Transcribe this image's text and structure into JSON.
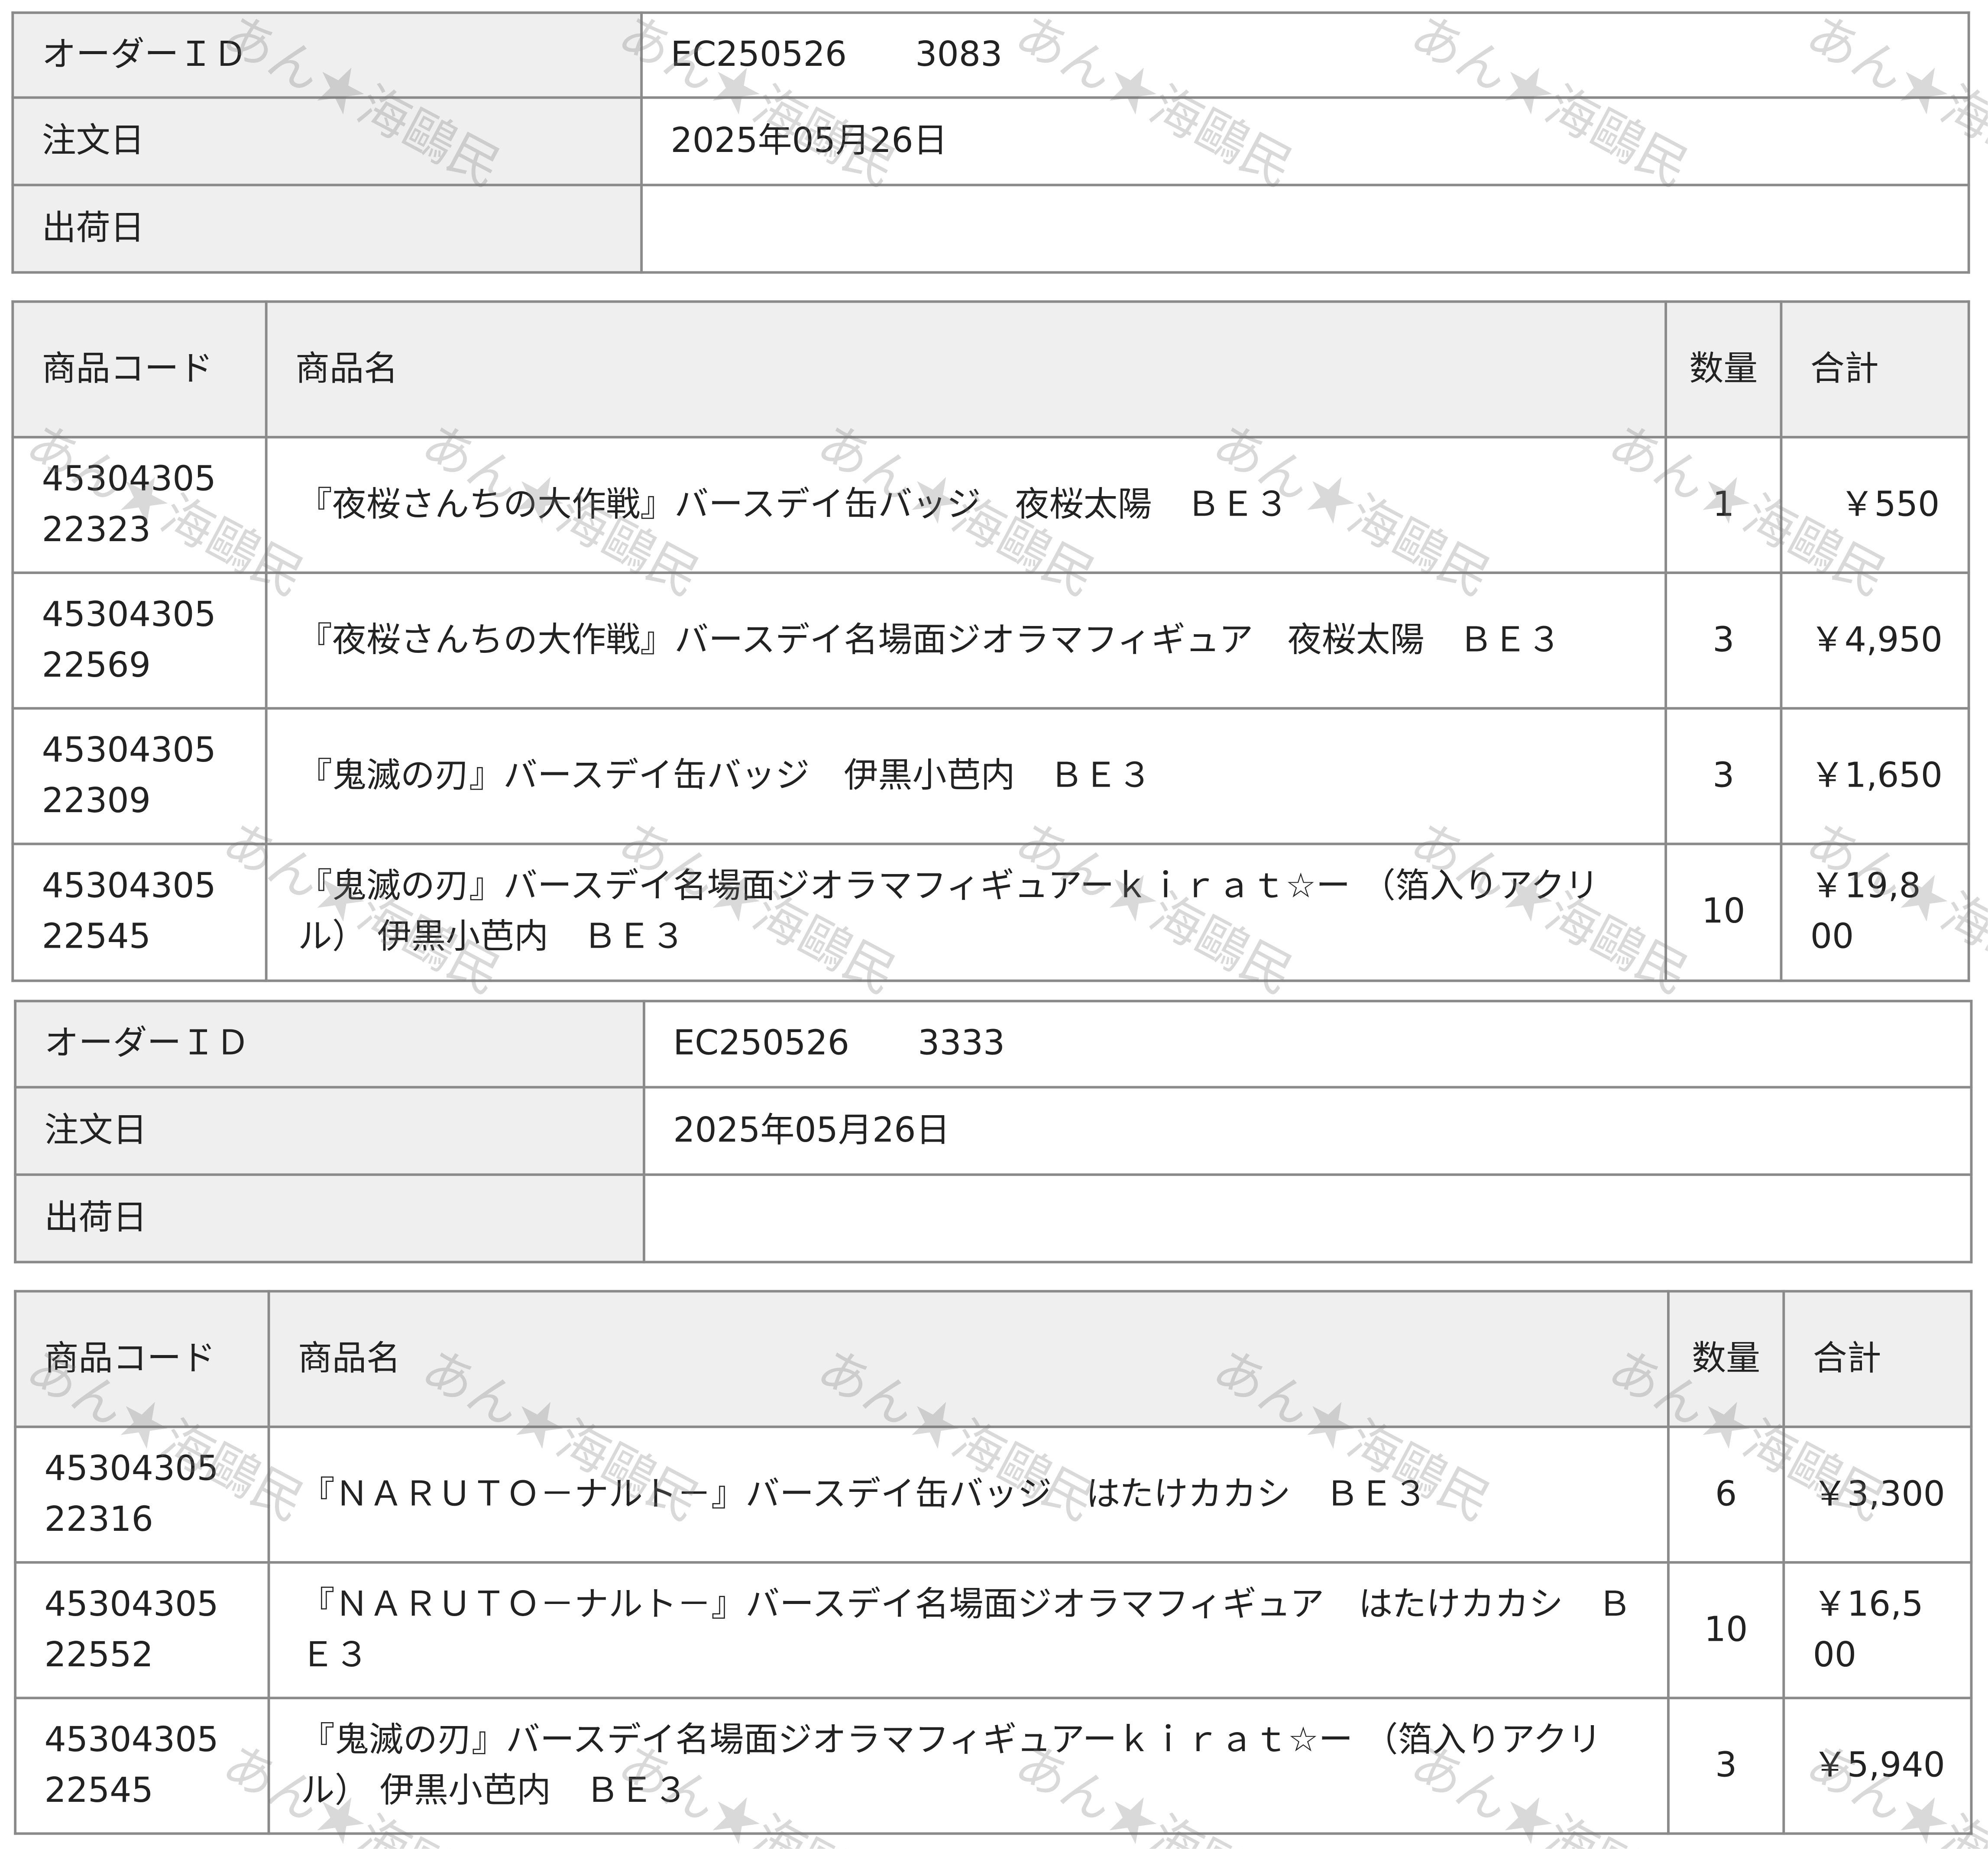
{
  "labels": {
    "order_id": "オーダーＩＤ",
    "order_date": "注文日",
    "ship_date": "出荷日",
    "col_code": "商品コード",
    "col_name": "商品名",
    "col_qty": "数量",
    "col_total": "合計"
  },
  "watermark": "あん★海鷗民",
  "orders": [
    {
      "order_id": "EC250526　　3083",
      "order_date": "2025年05月26日",
      "ship_date": "",
      "items": [
        {
          "code": "4530430522323",
          "name": "『夜桜さんちの大作戦』バースデイ缶バッジ　夜桜太陽　ＢＥ３",
          "qty": "1",
          "total": "￥550"
        },
        {
          "code": "4530430522569",
          "name": "『夜桜さんちの大作戦』バースデイ名場面ジオラマフィギュア　夜桜太陽　ＢＥ３",
          "qty": "3",
          "total": "￥4,950"
        },
        {
          "code": "4530430522309",
          "name": "『鬼滅の刃』バースデイ缶バッジ　伊黒小芭内　ＢＥ３",
          "qty": "3",
          "total": "￥1,650"
        },
        {
          "code": "4530430522545",
          "name": "『鬼滅の刃』バースデイ名場面ジオラマフィギュアーｋｉｒａｔ☆ー （箔入りアクリル） 伊黒小芭内　ＢＥ３",
          "qty": "10",
          "total": "￥19,800"
        }
      ]
    },
    {
      "order_id": "EC250526　　3333",
      "order_date": "2025年05月26日",
      "ship_date": "",
      "items": [
        {
          "code": "4530430522316",
          "name": "『ＮＡＲＵＴＯ－ナルト－』バースデイ缶バッジ　はたけカカシ　ＢＥ３",
          "qty": "6",
          "total": "￥3,300"
        },
        {
          "code": "4530430522552",
          "name": "『ＮＡＲＵＴＯ－ナルト－』バースデイ名場面ジオラマフィギュア　はたけカカシ　ＢＥ３",
          "qty": "10",
          "total": "￥16,500"
        },
        {
          "code": "4530430522545",
          "name": "『鬼滅の刃』バースデイ名場面ジオラマフィギュアーｋｉｒａｔ☆ー （箔入りアクリル） 伊黒小芭内　ＢＥ３",
          "qty": "3",
          "total": "￥5,940"
        }
      ]
    }
  ]
}
